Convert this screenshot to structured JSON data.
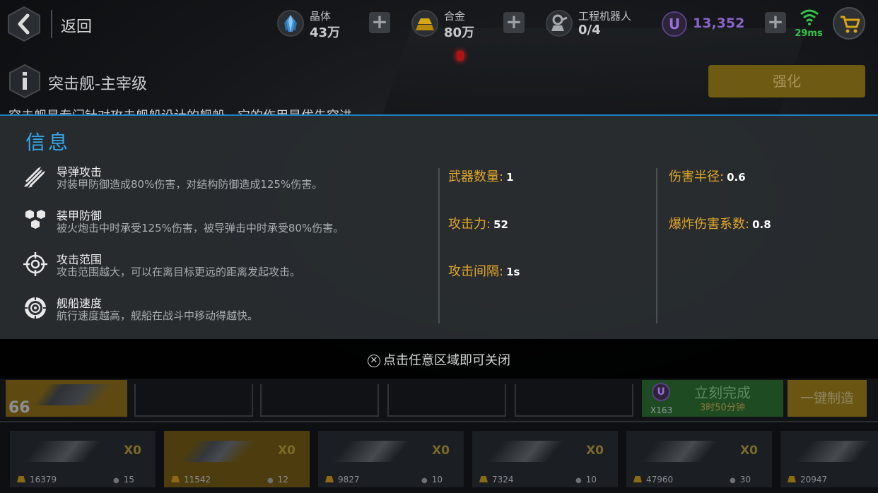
{
  "topbar": {
    "back_label": "返回",
    "resources": [
      {
        "name": "晶体",
        "value": "43万",
        "icon": "crystal-icon"
      },
      {
        "name": "合金",
        "value": "80万",
        "icon": "alloy-icon"
      },
      {
        "name": "工程机器人",
        "value": "0/4",
        "icon": "robot-icon"
      }
    ],
    "currency_symbol": "U",
    "currency_value": "13,352",
    "ping": "29ms"
  },
  "ship": {
    "title": "突击舰-主宰级",
    "upgrade_label": "强化",
    "description_peek": "突击舰是专门针对攻击舰船设计的舰船，它的作用是优先突进"
  },
  "overlay": {
    "title": "信息",
    "features": [
      {
        "name": "导弹攻击",
        "desc": "对装甲防御造成80%伤害，对结构防御造成125%伤害。",
        "icon": "missile-attack-icon"
      },
      {
        "name": "装甲防御",
        "desc": "被火炮击中时承受125%伤害，被导弹击中时承受80%伤害。",
        "icon": "armor-defense-icon"
      },
      {
        "name": "攻击范围",
        "desc": "攻击范围越大，可以在离目标更远的距离发起攻击。",
        "icon": "crosshair-icon"
      },
      {
        "name": "舰船速度",
        "desc": "航行速度越高，舰船在战斗中移动得越快。",
        "icon": "speed-icon"
      }
    ],
    "stats_col1": [
      {
        "label": "武器数量:",
        "value": "1"
      },
      {
        "label": "攻击力:",
        "value": "52"
      },
      {
        "label": "攻击间隔:",
        "value": "1s"
      }
    ],
    "stats_col2": [
      {
        "label": "伤害半径:",
        "value": "0.6"
      },
      {
        "label": "爆炸伤害系数:",
        "value": "0.8"
      }
    ],
    "close_hint": "点击任意区域即可关闭",
    "close_symbol": "✕"
  },
  "build": {
    "level": "66",
    "instant_label": "立刻完成",
    "instant_cost": "X163",
    "instant_time": "3时50分钟",
    "instant_currency": "U",
    "oneclick_label": "一键制造"
  },
  "ships": [
    {
      "count": "X0",
      "cost": "16379",
      "crew": "15"
    },
    {
      "count": "X0",
      "cost": "11542",
      "crew": "12"
    },
    {
      "count": "X0",
      "cost": "9827",
      "crew": "10"
    },
    {
      "count": "X0",
      "cost": "7324",
      "crew": "10"
    },
    {
      "count": "X0",
      "cost": "47960",
      "crew": "30"
    },
    {
      "count": "",
      "cost": "20947",
      "crew": ""
    }
  ],
  "colors": {
    "accent_blue": "#35a8ec",
    "stat_label": "#e0a62a",
    "upgrade_gold": "#6e5a12",
    "currency_purple": "#8a64c6",
    "ping_green": "#35c24a"
  }
}
